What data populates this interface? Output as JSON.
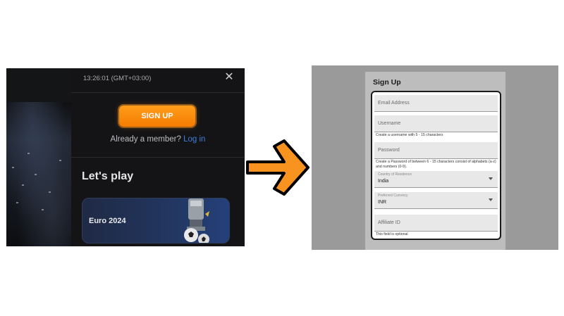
{
  "left_panel": {
    "time": "13:26:01 (GMT+03:00)",
    "close_label": "✕",
    "signup_label": "SIGN UP",
    "member_text": "Already a member?",
    "login_label": "Log in",
    "section_title": "Let's play",
    "card_label": "Euro 2024"
  },
  "right_panel": {
    "form_title": "Sign Up",
    "email_placeholder": "Email Address",
    "username_placeholder": "Username",
    "username_helper": "Create a username with 5 - 15 characters",
    "password_placeholder": "Password",
    "password_helper": "Create a Password of between 6 - 15 characters consist of alphabets (a-z) and numbers (0-9).",
    "country_label": "Country of Residence",
    "country_value": "India",
    "currency_label": "Preferred Currency",
    "currency_value": "INR",
    "affiliate_placeholder": "Affiliate ID",
    "affiliate_helper": "This field is optional"
  },
  "colors": {
    "accent_orange": "#f57c00",
    "login_link": "#3f7fd8",
    "arrow_orange": "#f7931e"
  }
}
